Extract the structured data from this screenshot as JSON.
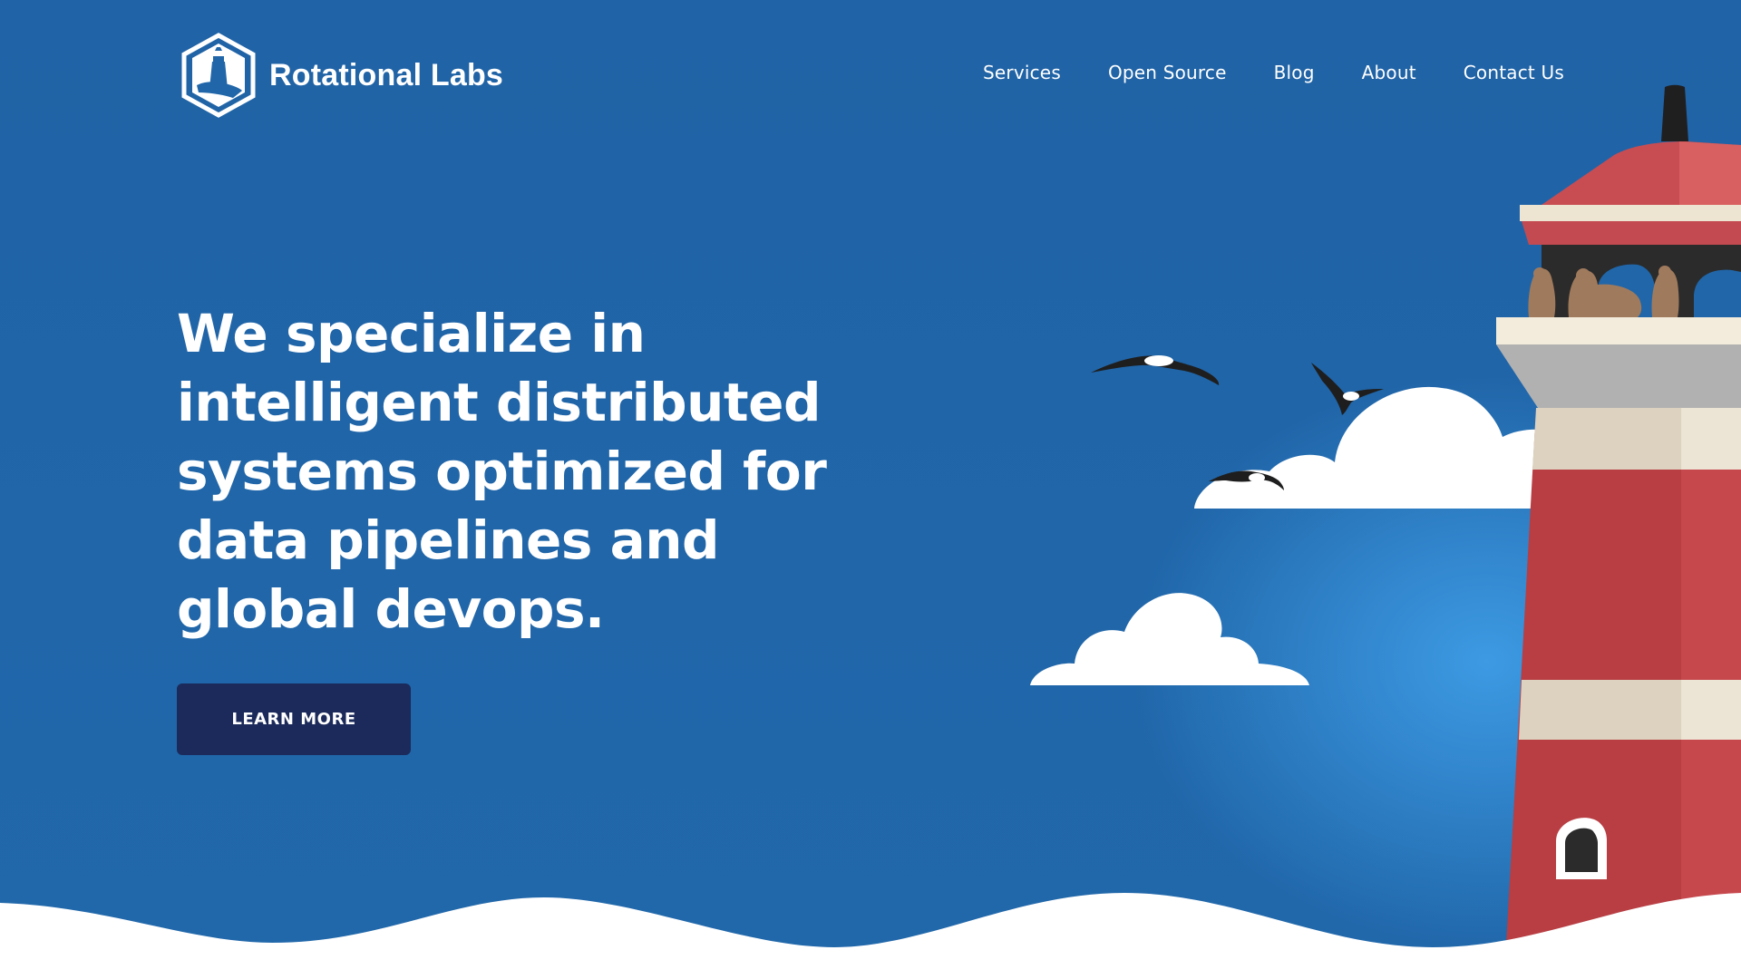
{
  "header": {
    "brand": "Rotational Labs",
    "logo_icon": "lighthouse-hexagon-logo",
    "nav": [
      {
        "label": "Services"
      },
      {
        "label": "Open Source"
      },
      {
        "label": "Blog"
      },
      {
        "label": "About"
      },
      {
        "label": "Contact Us"
      }
    ]
  },
  "hero": {
    "headline": "We specialize in intelligent distributed systems optimized for data pipelines and global devops.",
    "cta_label": "LEARN MORE"
  },
  "illustration": {
    "items": [
      "lighthouse",
      "seagulls",
      "clouds",
      "otters",
      "waves"
    ]
  },
  "colors": {
    "background": "#2066a9",
    "button": "#1b2a5a",
    "lighthouse_red": "#c0444a",
    "lighthouse_cream": "#ece4d4",
    "text": "#ffffff"
  }
}
